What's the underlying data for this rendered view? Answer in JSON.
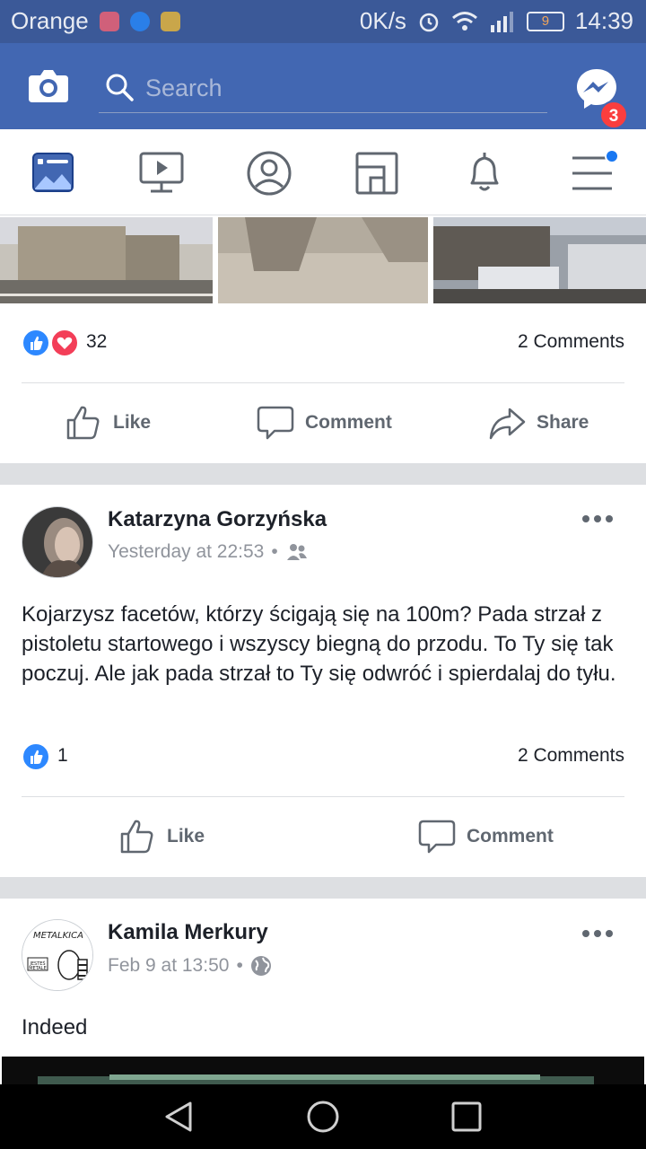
{
  "status_bar": {
    "carrier": "Orange",
    "net_speed": "0K/s",
    "battery": "9",
    "time": "14:39"
  },
  "topbar": {
    "search_placeholder": "Search",
    "messenger_badge": "3"
  },
  "tabs": [
    {
      "name": "news-feed",
      "active": true
    },
    {
      "name": "watch"
    },
    {
      "name": "profile"
    },
    {
      "name": "marketplace"
    },
    {
      "name": "notifications"
    },
    {
      "name": "menu",
      "has_dot": true
    }
  ],
  "post1": {
    "reaction_count": "32",
    "comments": "2 Comments",
    "actions": {
      "like": "Like",
      "comment": "Comment",
      "share": "Share"
    }
  },
  "post2": {
    "author": "Katarzyna Gorzyńska",
    "time": "Yesterday at 22:53",
    "text": "Kojarzysz facetów, którzy ścigają się na 100m? Pada strzał z pistoletu startowego i wszyscy biegną do przodu. To Ty się tak poczuj. Ale jak pada strzał to Ty się odwróć i spierdalaj do tyłu.",
    "reaction_count": "1",
    "comments": "2 Comments",
    "actions": {
      "like": "Like",
      "comment": "Comment"
    }
  },
  "post3": {
    "author": "Kamila Merkury",
    "time": "Feb 9 at 13:50",
    "text": "Indeed",
    "avatar_text": [
      "METALKICA",
      "JESTEŚ METALE"
    ]
  },
  "colors": {
    "brand": "#4267b2",
    "status": "#3b5998",
    "like_blue": "#2d88ff",
    "love_red": "#f33e58",
    "muted": "#606770"
  }
}
